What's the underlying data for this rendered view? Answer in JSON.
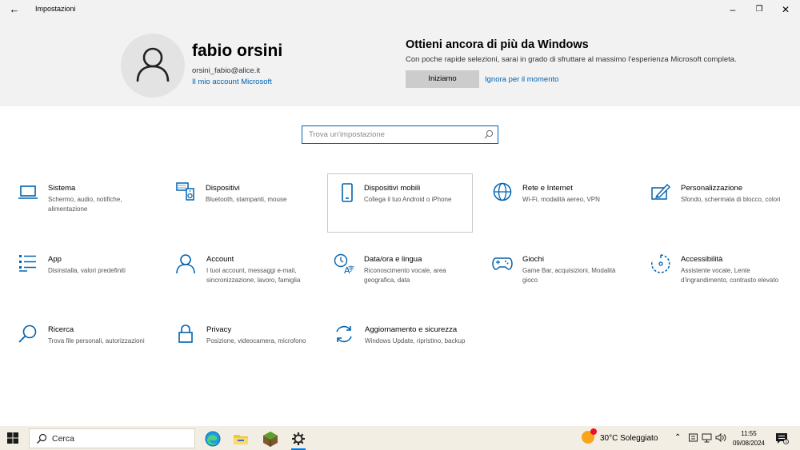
{
  "window": {
    "title": "Impostazioni",
    "back_icon": "arrow-left-icon",
    "minimize": "–",
    "maximize": "❐",
    "close": "✕"
  },
  "header": {
    "user_name": "fabio orsini",
    "user_email": "orsini_fabio@alice.it",
    "account_link": "Il mio account Microsoft",
    "promo_title": "Ottieni ancora di più da Windows",
    "promo_text": "Con poche rapide selezioni, sarai in grado di sfruttare al massimo l'esperienza Microsoft completa.",
    "promo_button": "Iniziamo",
    "promo_skip": "Ignora per il momento"
  },
  "search": {
    "placeholder": "Trova un'impostazione"
  },
  "accent_color": "#0063b1",
  "tiles": [
    {
      "name": "Sistema",
      "desc": "Schermo, audio, notifiche, alimentazione",
      "icon": "laptop-icon"
    },
    {
      "name": "Dispositivi",
      "desc": "Bluetooth, stampanti, mouse",
      "icon": "keyboard-speaker-icon"
    },
    {
      "name": "Dispositivi mobili",
      "desc": "Collega il tuo Android o iPhone",
      "icon": "phone-icon"
    },
    {
      "name": "Rete e Internet",
      "desc": "Wi-Fi, modalità aereo, VPN",
      "icon": "globe-icon"
    },
    {
      "name": "Personalizzazione",
      "desc": "Sfondo, schermata di blocco, colori",
      "icon": "paint-icon"
    },
    {
      "name": "App",
      "desc": "Disinstalla, valori predefiniti",
      "icon": "app-list-icon"
    },
    {
      "name": "Account",
      "desc": "I tuoi account, messaggi e-mail, sincronizzazione, lavoro, famiglia",
      "icon": "person-icon"
    },
    {
      "name": "Data/ora e lingua",
      "desc": "Riconoscimento vocale, area geografica, data",
      "icon": "time-language-icon"
    },
    {
      "name": "Giochi",
      "desc": "Game Bar, acquisizioni, Modalità gioco",
      "icon": "gamepad-icon"
    },
    {
      "name": "Accessibilità",
      "desc": "Assistente vocale, Lente d'ingrandimento, contrasto elevato",
      "icon": "accessibility-icon"
    },
    {
      "name": "Ricerca",
      "desc": "Trova file personali, autorizzazioni",
      "icon": "search-icon"
    },
    {
      "name": "Privacy",
      "desc": "Posizione, videocamera, microfono",
      "icon": "lock-icon"
    },
    {
      "name": "Aggiornamento e sicurezza",
      "desc": "Windows Update, ripristino, backup",
      "icon": "update-icon"
    }
  ],
  "taskbar": {
    "search_label": "Cerca",
    "weather": "30°C  Soleggiato",
    "time": "11:55",
    "date": "09/08/2024",
    "apps": [
      "edge-icon",
      "file-explorer-icon",
      "minecraft-icon",
      "settings-gear-icon"
    ]
  }
}
